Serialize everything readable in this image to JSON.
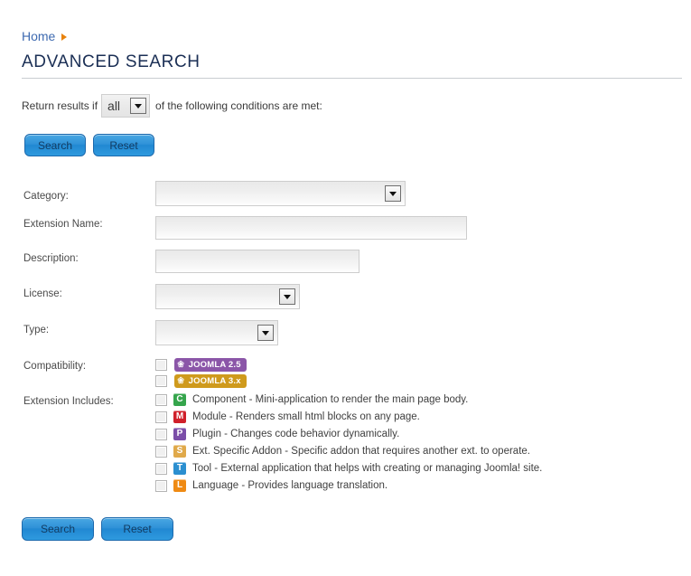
{
  "breadcrumb": {
    "home_label": "Home",
    "separator_icon": "triangle-right-icon"
  },
  "page_title": "ADVANCED SEARCH",
  "condition_row": {
    "prefix_text": "Return results if",
    "match_value": "all",
    "suffix_text": "of the following conditions are met:"
  },
  "buttons_top": {
    "search_label": "Search",
    "reset_label": "Reset"
  },
  "buttons_bottom": {
    "search_label": "Search",
    "reset_label": "Reset"
  },
  "fields": {
    "category": {
      "label": "Category:",
      "value": ""
    },
    "extension_name": {
      "label": "Extension Name:",
      "value": ""
    },
    "description": {
      "label": "Description:",
      "value": ""
    },
    "license": {
      "label": "License:",
      "value": ""
    },
    "type": {
      "label": "Type:",
      "value": ""
    },
    "compatibility": {
      "label": "Compatibility:"
    },
    "extension_includes": {
      "label": "Extension Includes:"
    }
  },
  "compatibility_options": [
    {
      "label": "JOOMLA 2.5",
      "color": "#8b56a8",
      "checked": false,
      "icon": "joomla-logo-icon"
    },
    {
      "label": "JOOMLA 3.x",
      "color": "#cf9a1c",
      "checked": false,
      "icon": "joomla-logo-icon"
    }
  ],
  "extension_includes_options": [
    {
      "letter": "C",
      "color": "#35a54c",
      "text": "Component - Mini-application to render the main page body.",
      "checked": false,
      "icon": "component-icon"
    },
    {
      "letter": "M",
      "color": "#d0202a",
      "text": "Module - Renders small html blocks on any page.",
      "checked": false,
      "icon": "module-icon"
    },
    {
      "letter": "P",
      "color": "#7b4ea8",
      "text": "Plugin - Changes code behavior dynamically.",
      "checked": false,
      "icon": "plugin-icon"
    },
    {
      "letter": "S",
      "color": "#e0a94a",
      "text": "Ext. Specific Addon - Specific addon that requires another ext. to operate.",
      "checked": false,
      "icon": "addon-icon"
    },
    {
      "letter": "T",
      "color": "#2b8fd0",
      "text": "Tool - External application that helps with creating or managing Joomla! site.",
      "checked": false,
      "icon": "tool-icon"
    },
    {
      "letter": "L",
      "color": "#ef8a13",
      "text": "Language - Provides language translation.",
      "checked": false,
      "icon": "language-icon"
    }
  ],
  "theme": {
    "link_color": "#3e6ab0",
    "title_color": "#1b2f55",
    "accent_orange": "#e8820c",
    "button_blue": "#2f92d8"
  }
}
